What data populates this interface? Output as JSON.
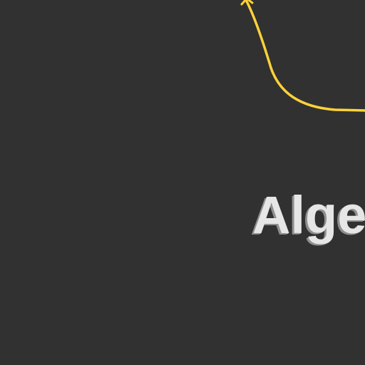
{
  "canvas": {
    "background_color": "#313131"
  },
  "connector": {
    "color": "#fdd23a",
    "arrowhead": "arrow-up-icon"
  },
  "label": {
    "text": "Alge",
    "color": "#e6e6e6"
  }
}
